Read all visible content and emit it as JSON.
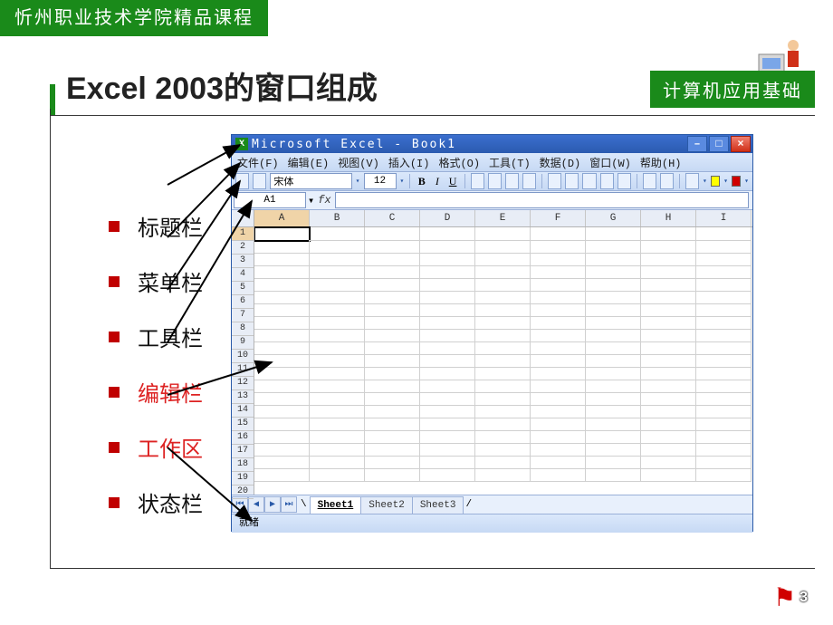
{
  "banner": "忻州职业技术学院精品课程",
  "course_box": "计算机应用基础",
  "page_title": "Excel 2003的窗口组成",
  "page_number": "3",
  "bullets": [
    {
      "label": "标题栏",
      "highlight": false
    },
    {
      "label": "菜单栏",
      "highlight": false
    },
    {
      "label": "工具栏",
      "highlight": false
    },
    {
      "label": "编辑栏",
      "highlight": true
    },
    {
      "label": "工作区",
      "highlight": true
    },
    {
      "label": "状态栏",
      "highlight": false
    }
  ],
  "excel": {
    "title": "Microsoft Excel - Book1",
    "menus": [
      "文件(F)",
      "编辑(E)",
      "视图(V)",
      "插入(I)",
      "格式(O)",
      "工具(T)",
      "数据(D)",
      "窗口(W)",
      "帮助(H)"
    ],
    "toolbar": {
      "font_name": "宋体",
      "font_size": "12"
    },
    "namebox": "A1",
    "columns": [
      "A",
      "B",
      "C",
      "D",
      "E",
      "F",
      "G",
      "H",
      "I"
    ],
    "row_count": 20,
    "sheets": [
      "Sheet1",
      "Sheet2",
      "Sheet3"
    ],
    "active_sheet_index": 0,
    "status": "就绪"
  }
}
